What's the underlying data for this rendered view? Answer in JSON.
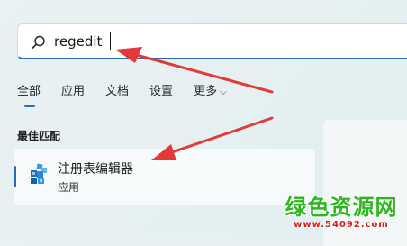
{
  "search": {
    "value": "regedit"
  },
  "tabs": [
    {
      "label": "全部",
      "active": true
    },
    {
      "label": "应用",
      "active": false
    },
    {
      "label": "文档",
      "active": false
    },
    {
      "label": "设置",
      "active": false
    },
    {
      "label": "更多",
      "active": false,
      "dropdown": true
    }
  ],
  "best_match": {
    "heading": "最佳匹配",
    "result": {
      "title": "注册表编辑器",
      "type": "应用",
      "icon": "registry-editor-icon"
    }
  },
  "watermark": {
    "title": "绿色资源网",
    "url": "www.54092.com"
  },
  "colors": {
    "accent": "#2b6cb5",
    "arrow": "#e23a3a",
    "watermark_green": "#2fb51f",
    "watermark_red": "#d01e1e"
  }
}
